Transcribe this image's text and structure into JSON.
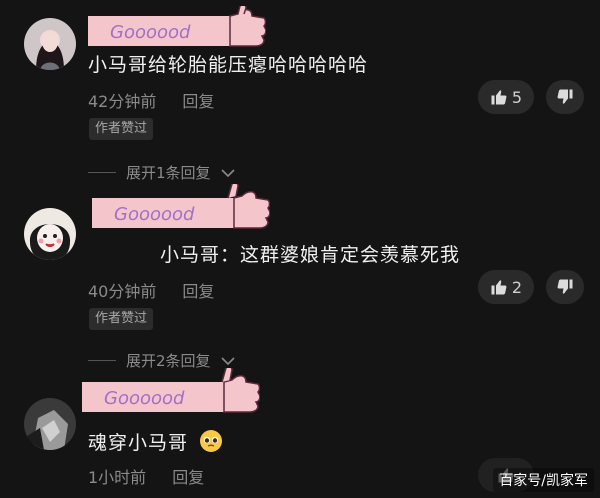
{
  "comments": [
    {
      "text": "小马哥给轮胎能压瘪哈哈哈哈哈",
      "time": "42分钟前",
      "reply_label": "回复",
      "badge": "作者赞过",
      "likes": "5",
      "expand_label": "展开1条回复"
    },
    {
      "text": "小马哥：这群婆娘肯定会羡慕死我",
      "time": "40分钟前",
      "reply_label": "回复",
      "badge": "作者赞过",
      "likes": "2",
      "expand_label": "展开2条回复"
    },
    {
      "text": "魂穿小马哥",
      "time": "1小时前",
      "reply_label": "回复"
    }
  ],
  "sticker_text": "Goooood",
  "watermark": "百家号/凯家军",
  "colors": {
    "background": "#141414",
    "sticker_pink": "#f4c6cc",
    "sticker_text": "#a070c8"
  }
}
